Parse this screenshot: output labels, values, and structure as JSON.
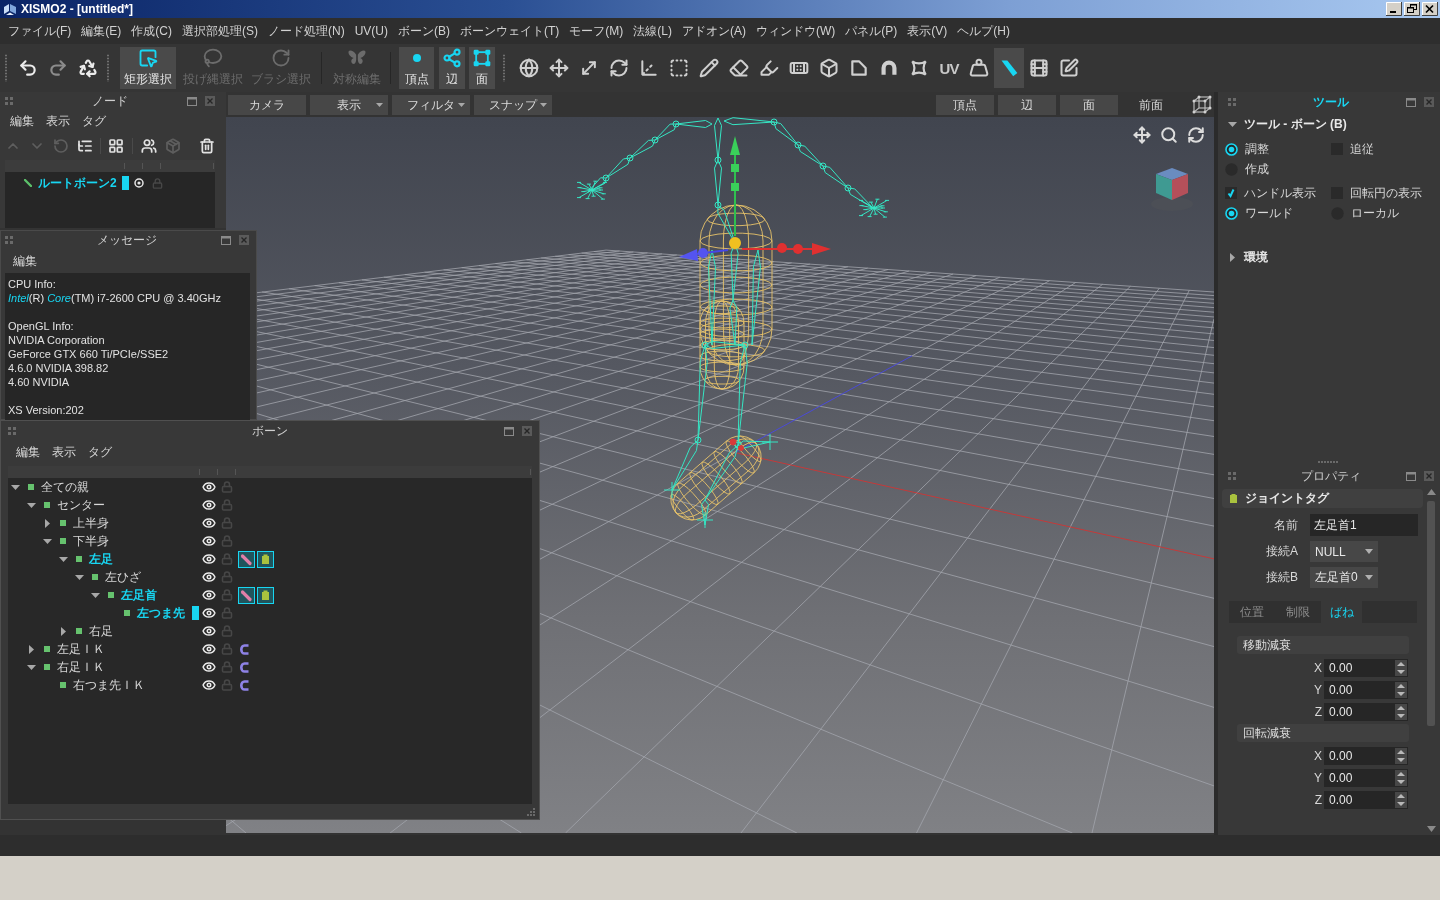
{
  "window": {
    "title": "XISMO2 - [untitled*]"
  },
  "menu": [
    "ファイル(F)",
    "編集(E)",
    "作成(C)",
    "選択部処理(S)",
    "ノード処理(N)",
    "UV(U)",
    "ボーン(B)",
    "ボーンウェイト(T)",
    "モーフ(M)",
    "法線(L)",
    "アドオン(A)",
    "ウィンドウ(W)",
    "パネル(P)",
    "表示(V)",
    "ヘルプ(H)"
  ],
  "toolbar": {
    "history": [
      {
        "disabled": false
      },
      {
        "disabled": true
      },
      {
        "disabled": false
      }
    ],
    "select_modes": [
      {
        "label": "矩形選択",
        "selected": true,
        "disabled": false
      },
      {
        "label": "投げ縄選択",
        "selected": false,
        "disabled": true
      },
      {
        "label": "ブラシ選択",
        "selected": false,
        "disabled": true
      }
    ],
    "symmetry": {
      "label": "対称編集",
      "disabled": true
    },
    "elements": [
      {
        "label": "頂点",
        "selected": true
      },
      {
        "label": "辺",
        "selected": true
      },
      {
        "label": "面",
        "selected": true
      }
    ],
    "tools": [
      {
        "kind": "icon",
        "selected": false
      },
      {
        "kind": "icon",
        "selected": false
      },
      {
        "kind": "icon",
        "selected": false
      },
      {
        "kind": "icon",
        "selected": false
      },
      {
        "kind": "icon",
        "selected": false
      },
      {
        "kind": "icon",
        "selected": false
      },
      {
        "kind": "icon",
        "selected": false
      },
      {
        "kind": "icon",
        "selected": false
      },
      {
        "kind": "icon",
        "selected": false
      },
      {
        "kind": "icon",
        "selected": false
      },
      {
        "kind": "icon",
        "selected": false
      },
      {
        "kind": "icon",
        "selected": false
      },
      {
        "kind": "icon",
        "selected": false
      },
      {
        "kind": "icon",
        "selected": false
      },
      {
        "kind": "text",
        "text": "UV",
        "selected": false
      },
      {
        "kind": "icon",
        "selected": false
      },
      {
        "kind": "icon",
        "selected": true
      },
      {
        "kind": "icon",
        "selected": false
      },
      {
        "kind": "icon",
        "selected": false
      }
    ]
  },
  "node_panel": {
    "title": "ノード",
    "active": false,
    "menu": [
      "編集",
      "表示",
      "タグ"
    ],
    "tools": [
      {
        "disabled": true
      },
      {
        "disabled": true
      },
      {
        "disabled": true
      },
      {
        "disabled": false
      },
      {
        "disabled": false
      },
      {
        "disabled": false
      },
      {
        "disabled": true
      },
      {
        "disabled": false
      }
    ],
    "rows": [
      {
        "label": "ルートボーン2",
        "selected": true,
        "current": true,
        "visible": true,
        "locked": false
      }
    ]
  },
  "message_panel": {
    "title": "メッセージ",
    "active": false,
    "menu": [
      "編集"
    ],
    "blocks": [
      [
        "CPU Info:",
        "*Intel*(R) *Core*(TM) i7-2600 CPU @ 3.40GHz"
      ],
      [
        "OpenGL Info:",
        "NVIDIA Corporation",
        "GeForce GTX 660 Ti/PCIe/SSE2",
        "4.6.0 NVIDIA 398.82",
        "4.60 NVIDIA"
      ],
      [
        "XS Version:202"
      ]
    ]
  },
  "bone_panel": {
    "title": "ボーン",
    "active": false,
    "menu": [
      "編集",
      "表示",
      "タグ"
    ],
    "tree": [
      {
        "label": "全ての親",
        "expanded": true,
        "selected": false,
        "current": false,
        "visible": true,
        "locked": false,
        "children": [
          {
            "label": "センター",
            "expanded": true,
            "selected": false,
            "current": false,
            "visible": true,
            "locked": false,
            "children": [
              {
                "label": "上半身",
                "expanded": false,
                "selected": false,
                "current": false,
                "visible": true,
                "locked": false
              },
              {
                "label": "下半身",
                "expanded": true,
                "selected": false,
                "current": false,
                "visible": true,
                "locked": false,
                "children": [
                  {
                    "label": "左足",
                    "expanded": true,
                    "selected": true,
                    "current": false,
                    "visible": true,
                    "locked": false,
                    "tags": [
                      {
                        "kind": "marker"
                      },
                      {
                        "kind": "joint"
                      }
                    ],
                    "children": [
                      {
                        "label": "左ひざ",
                        "expanded": true,
                        "selected": false,
                        "current": false,
                        "visible": true,
                        "locked": false,
                        "children": [
                          {
                            "label": "左足首",
                            "expanded": true,
                            "selected": true,
                            "current": false,
                            "visible": true,
                            "locked": false,
                            "tags": [
                              {
                                "kind": "marker"
                              },
                              {
                                "kind": "joint"
                              }
                            ],
                            "children": [
                              {
                                "label": "左つま先",
                                "selected": true,
                                "current": true,
                                "visible": true,
                                "locked": false
                              }
                            ]
                          }
                        ]
                      }
                    ]
                  },
                  {
                    "label": "右足",
                    "expanded": false,
                    "selected": false,
                    "current": false,
                    "visible": true,
                    "locked": false
                  }
                ]
              }
            ]
          },
          {
            "label": "左足ＩＫ",
            "expanded": false,
            "selected": false,
            "current": false,
            "visible": true,
            "locked": false,
            "tags": [
              {
                "kind": "ik"
              }
            ]
          },
          {
            "label": "右足ＩＫ",
            "expanded": true,
            "selected": false,
            "current": false,
            "visible": true,
            "locked": false,
            "tags": [
              {
                "kind": "ik"
              }
            ],
            "children": [
              {
                "label": "右つま先ＩＫ",
                "selected": false,
                "current": false,
                "visible": true,
                "locked": false,
                "tags": [
                  {
                    "kind": "ik"
                  }
                ]
              }
            ]
          }
        ]
      }
    ]
  },
  "viewport": {
    "toolbar": {
      "left": [
        {
          "label": "カメラ",
          "dropdown": false
        },
        {
          "label": "表示",
          "dropdown": true
        },
        {
          "label": "フィルタ",
          "dropdown": true
        },
        {
          "label": "スナップ",
          "dropdown": true
        }
      ],
      "right": [
        {
          "kind": "button",
          "label": "頂点"
        },
        {
          "kind": "button",
          "label": "辺"
        },
        {
          "kind": "button",
          "label": "面"
        },
        {
          "kind": "label",
          "label": "前面"
        }
      ]
    }
  },
  "tool_panel": {
    "title": "ツール",
    "active": true,
    "section": {
      "title": "ツール - ボーン (B)",
      "expanded": true
    },
    "options": [
      [
        {
          "kind": "radio",
          "label": "調整",
          "checked": true
        },
        {
          "kind": "checkbox",
          "label": "追従",
          "checked": false
        }
      ],
      [
        {
          "kind": "radio",
          "label": "作成",
          "checked": false
        }
      ],
      [
        {
          "kind": "checkbox",
          "label": "ハンドル表示",
          "checked": true
        },
        {
          "kind": "checkbox",
          "label": "回転円の表示",
          "checked": false
        }
      ],
      [
        {
          "kind": "radio",
          "label": "ワールド",
          "checked": true
        },
        {
          "kind": "radio",
          "label": "ローカル",
          "checked": false
        }
      ]
    ],
    "subsection": {
      "title": "環境",
      "expanded": false
    }
  },
  "properties_panel": {
    "title": "プロパティ",
    "active": false,
    "section": {
      "title": "ジョイントタグ"
    },
    "fields": [
      {
        "kind": "text",
        "label": "名前",
        "value": "左足首1"
      },
      {
        "kind": "dropdown",
        "label": "接続A",
        "value": "NULL"
      },
      {
        "kind": "dropdown",
        "label": "接続B",
        "value": "左足首0"
      }
    ],
    "tabs": [
      {
        "label": "位置",
        "selected": false
      },
      {
        "label": "制限",
        "selected": false
      },
      {
        "label": "ばね",
        "selected": true
      }
    ],
    "groups": [
      {
        "title": "移動減衰",
        "axes": [
          {
            "label": "X",
            "value": "0.00"
          },
          {
            "label": "Y",
            "value": "0.00"
          },
          {
            "label": "Z",
            "value": "0.00"
          }
        ]
      },
      {
        "title": "回転減衰",
        "axes": [
          {
            "label": "X",
            "value": "0.00"
          },
          {
            "label": "Y",
            "value": "0.00"
          },
          {
            "label": "Z",
            "value": "0.00"
          }
        ]
      }
    ]
  }
}
